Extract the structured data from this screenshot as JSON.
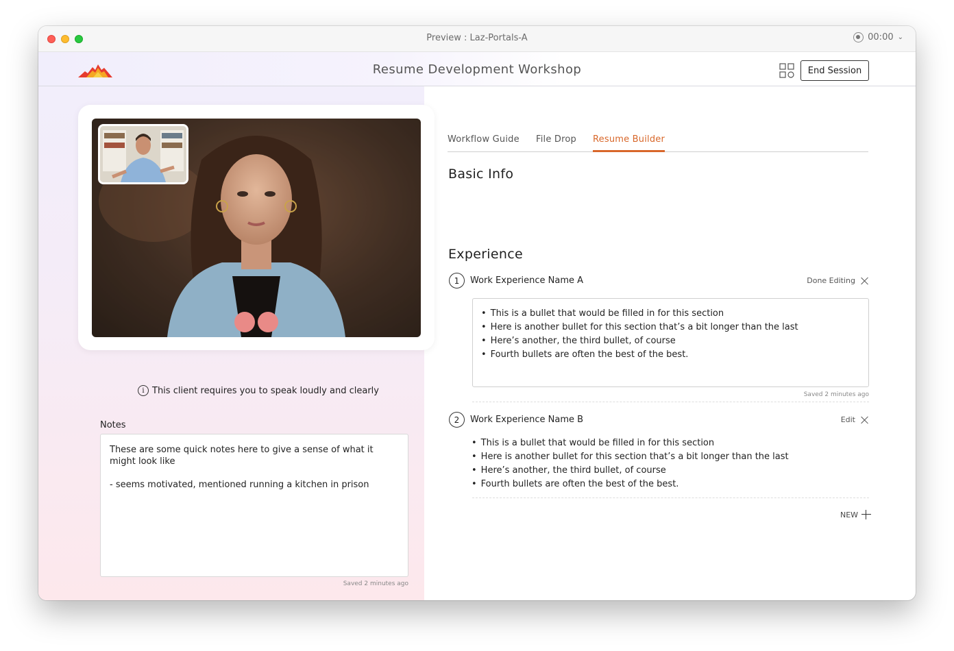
{
  "window": {
    "title": "Preview : Laz-Portals-A",
    "timer": "00:00"
  },
  "header": {
    "title": "Resume Development Workshop",
    "end_session_label": "End Session"
  },
  "video": {
    "client_note": "This client requires you to speak loudly and clearly"
  },
  "notes": {
    "label": "Notes",
    "text": "These are some quick notes here to give a sense of what it might look like\n\n- seems motivated, mentioned running a kitchen in prison",
    "saved": "Saved 2 minutes ago"
  },
  "tabs": [
    {
      "label": "Workflow Guide"
    },
    {
      "label": "File Drop"
    },
    {
      "label": "Resume Builder"
    }
  ],
  "builder": {
    "basic_info_heading": "Basic Info",
    "experience_heading": "Experience",
    "experiences": [
      {
        "number": "1",
        "name": "Work Experience Name A",
        "action": "Done Editing",
        "bullets": [
          "This is a bullet that would be filled in for this section",
          "Here is another bullet for this section that’s a bit longer than the last",
          "Here’s another, the third bullet, of course",
          "Fourth bullets are often the best of the best."
        ],
        "saved": "Saved 2 minutes ago"
      },
      {
        "number": "2",
        "name": "Work Experience Name B",
        "action": "Edit",
        "bullets": [
          "This is a bullet that would be filled in for this section",
          "Here is another bullet for this section that’s a bit longer than the last",
          "Here’s another, the third bullet, of course",
          "Fourth bullets are often the best of the best."
        ]
      }
    ],
    "new_label": "NEW"
  },
  "colors": {
    "accent": "#d8672a",
    "call_button": "#e98a87"
  }
}
